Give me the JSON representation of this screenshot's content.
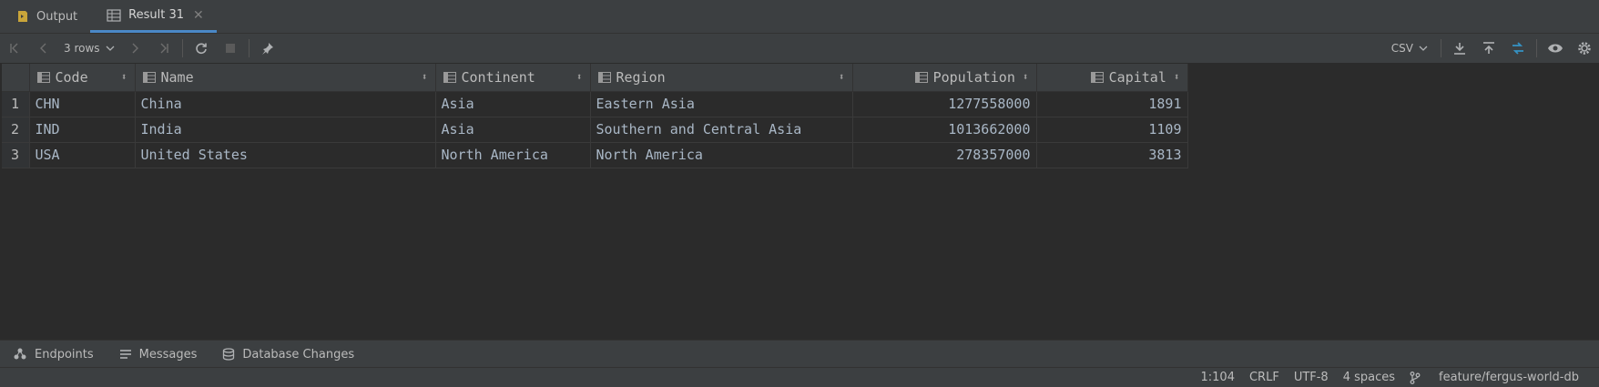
{
  "tabs": [
    {
      "label": "Output",
      "icon": "output-icon"
    },
    {
      "label": "Result 31",
      "icon": "table-icon",
      "active": true
    }
  ],
  "toolbar": {
    "rows_label": "3 rows",
    "export_format": "CSV"
  },
  "table": {
    "columns": [
      {
        "name": "Code",
        "align": "left"
      },
      {
        "name": "Name",
        "align": "left"
      },
      {
        "name": "Continent",
        "align": "left"
      },
      {
        "name": "Region",
        "align": "left"
      },
      {
        "name": "Population",
        "align": "right"
      },
      {
        "name": "Capital",
        "align": "right"
      }
    ],
    "rows": [
      {
        "num": "1",
        "cells": [
          "CHN",
          "China",
          "Asia",
          "Eastern Asia",
          "1277558000",
          "1891"
        ]
      },
      {
        "num": "2",
        "cells": [
          "IND",
          "India",
          "Asia",
          "Southern and Central Asia",
          "1013662000",
          "1109"
        ]
      },
      {
        "num": "3",
        "cells": [
          "USA",
          "United States",
          "North America",
          "North America",
          "278357000",
          "3813"
        ]
      }
    ]
  },
  "bottom_tabs": [
    {
      "label": "Endpoints",
      "icon": "endpoints-icon"
    },
    {
      "label": "Messages",
      "icon": "messages-icon"
    },
    {
      "label": "Database Changes",
      "icon": "database-changes-icon"
    }
  ],
  "status": {
    "position": "1:104",
    "line_ending": "CRLF",
    "encoding": "UTF-8",
    "indent": "4 spaces",
    "branch": "feature/fergus-world-db"
  },
  "colors": {
    "background": "#2b2b2b",
    "panel": "#3c3f41",
    "accent": "#4a88c7",
    "cell_text": "#a9b7c6"
  }
}
